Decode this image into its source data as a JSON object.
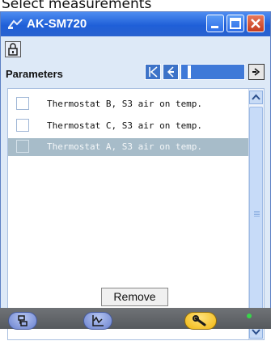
{
  "page": {
    "top_text": "Select measurements"
  },
  "window": {
    "title": "AK-SM720",
    "controls": {
      "minimize": "minimize",
      "maximize": "maximize",
      "close": "close"
    }
  },
  "toolbar": {
    "lock_icon": "lock-icon"
  },
  "parameters": {
    "label": "Parameters",
    "nav": {
      "first": "first-icon",
      "prev": "prev-icon",
      "next": "next-icon"
    },
    "items": [
      {
        "label": "Thermostat B, S3 air on temp.",
        "selected": false
      },
      {
        "label": "Thermostat C, S3 air on temp.",
        "selected": false
      },
      {
        "label": "Thermostat A, S3 air on temp.",
        "selected": true
      }
    ]
  },
  "actions": {
    "remove_label": "Remove"
  },
  "bottom_tabs": [
    {
      "name": "network-icon"
    },
    {
      "name": "chart-icon"
    },
    {
      "name": "wrench-icon",
      "active": true
    }
  ],
  "status": {
    "indicator_color": "#37d64a"
  }
}
